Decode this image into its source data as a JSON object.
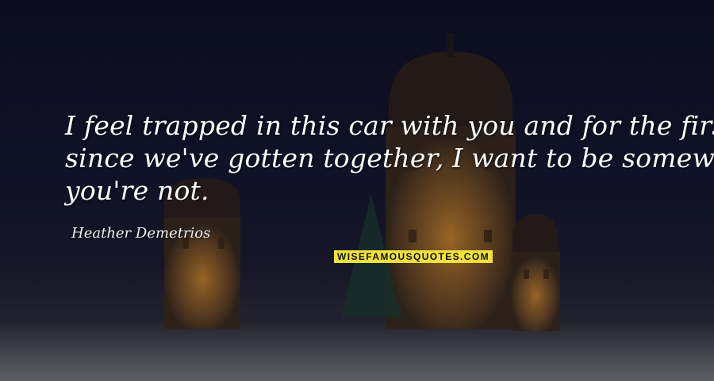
{
  "quote": {
    "lines": [
      "I feel trapped in this car with you and for the first time",
      "since we've gotten together, I want to be somewhere",
      "you're not."
    ]
  },
  "author": "Heather Demetrios",
  "brand": "WISEFAMOUSQUOTES.COM",
  "colors": {
    "quote_text": "#ffffff",
    "brand_bg": "#f0e23a",
    "brand_text": "#111111",
    "sky": "#0f1024"
  }
}
